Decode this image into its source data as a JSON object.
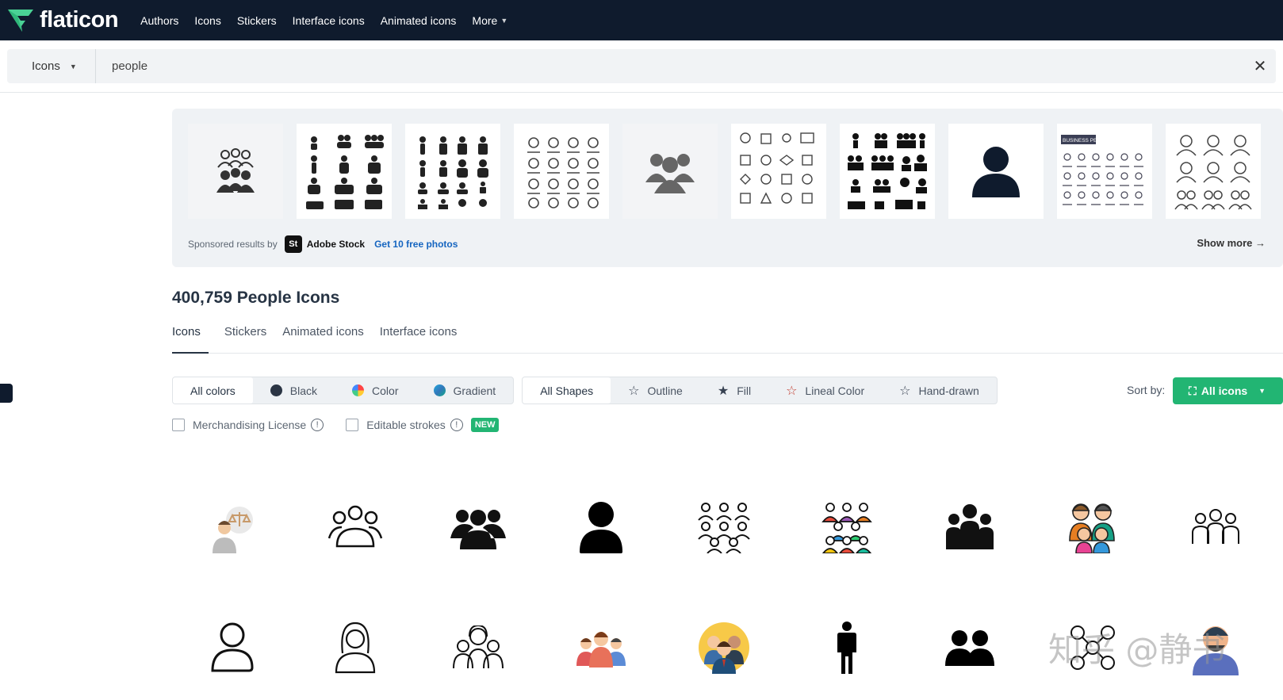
{
  "brand": {
    "name": "flaticon",
    "logo_color": "#4ad295"
  },
  "nav": {
    "items": [
      "Authors",
      "Icons",
      "Stickers",
      "Interface icons",
      "Animated icons"
    ],
    "more_label": "More"
  },
  "search": {
    "type_label": "Icons",
    "value": "people"
  },
  "sponsored": {
    "prefix": "Sponsored results by",
    "provider_badge": "St",
    "provider_name": "Adobe Stock",
    "cta": "Get 10 free photos",
    "show_more": "Show more →",
    "thumb_caption": "BUSINESS PEOPLE ICONS"
  },
  "results": {
    "title": "400,759 People Icons",
    "tabs": [
      "Icons",
      "Stickers",
      "Animated icons",
      "Interface icons"
    ]
  },
  "filters": {
    "colors": [
      "All colors",
      "Black",
      "Color",
      "Gradient"
    ],
    "shapes": [
      "All Shapes",
      "Outline",
      "Fill",
      "Lineal Color",
      "Hand-drawn"
    ],
    "sort_label": "Sort by:",
    "sort_value": "All icons",
    "merch_label": "Merchandising License",
    "editable_label": "Editable strokes",
    "new_badge": "NEW"
  },
  "colors": {
    "accent": "#22b573",
    "nav_bg": "#0f1b2d",
    "link": "#1565c0"
  },
  "watermark": "知乎 @静书"
}
